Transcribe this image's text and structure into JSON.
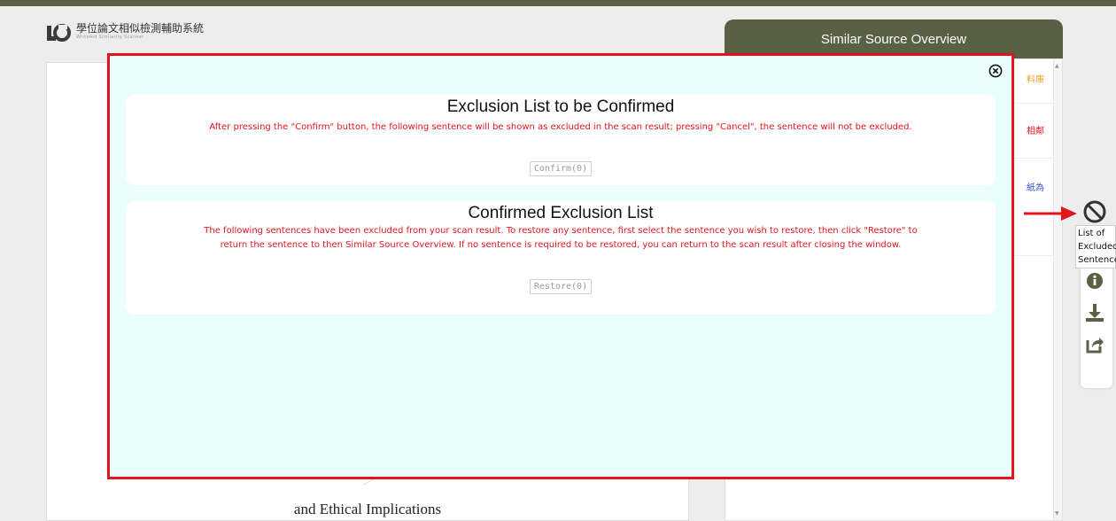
{
  "header": {
    "logo_title": "學位論文相似檢測輔助系統",
    "logo_subtitle": "WriteAid Similarity Scanner"
  },
  "document": {
    "visible_heading": "and Ethical Implications"
  },
  "overview": {
    "title": "Similar Source Overview",
    "snippets": [
      "料庫",
      "相鄰",
      "紙為"
    ]
  },
  "side_tools": {
    "tooltip_lines": [
      "List of",
      "Excluded",
      "Sentence"
    ],
    "icons": [
      "no-entry-icon",
      "info-icon",
      "download-icon",
      "share-icon"
    ]
  },
  "modal": {
    "pending": {
      "title": "Exclusion List to be Confirmed",
      "description": "After pressing the \"Confirm\" button, the following sentence will be shown as excluded in the scan result; pressing \"Cancel\", the sentence will not be excluded.",
      "button_label": "Confirm(0)"
    },
    "confirmed": {
      "title": "Confirmed Exclusion List",
      "description_line1": "The following sentences have been excluded from your scan result. To restore any sentence, first select the sentence you wish to restore, then click \"Restore\" to",
      "description_line2": "return the sentence to then Similar Source Overview. If no sentence is required to be restored, you can return to the scan result after closing the window.",
      "button_label": "Restore(0)"
    }
  },
  "colors": {
    "brand": "#596044",
    "highlight_red": "#e3151b",
    "modal_bg": "#ebfeff",
    "snippet_orange": "#f0a020",
    "snippet_red": "#e3151b",
    "snippet_blue": "#3355cc"
  }
}
